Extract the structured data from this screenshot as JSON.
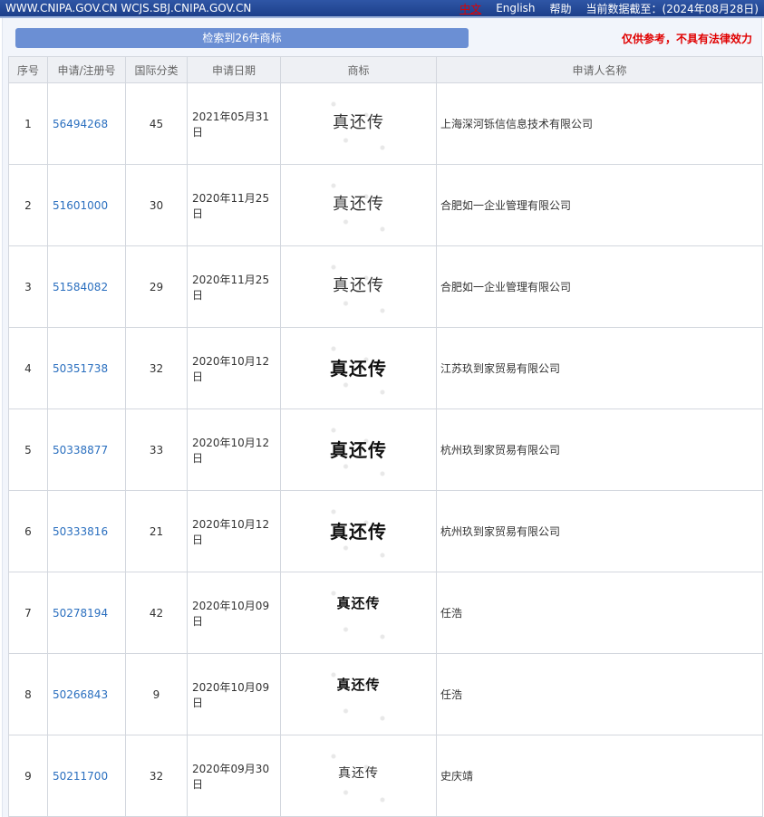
{
  "topbar": {
    "site": "WWW.CNIPA.GOV.CN WCJS.SBJ.CNIPA.GOV.CN",
    "lang_zh": "中文",
    "lang_en": "English",
    "help": "帮助",
    "data_as_of": "当前数据截至：(2024年08月28日)"
  },
  "summary": {
    "result_label": "检索到26件商标",
    "notice": "仅供参考，不具有法律效力"
  },
  "table": {
    "headers": [
      "序号",
      "申请/注册号",
      "国际分类",
      "申请日期",
      "商标",
      "申请人名称"
    ],
    "rows": [
      {
        "seq": "1",
        "reg": "56494268",
        "cls": "45",
        "date": "2021年05月31日",
        "mark": "真还传",
        "applicant": "上海深河铄信信息技术有限公司"
      },
      {
        "seq": "2",
        "reg": "51601000",
        "cls": "30",
        "date": "2020年11月25日",
        "mark": "真还传",
        "applicant": "合肥如一企业管理有限公司"
      },
      {
        "seq": "3",
        "reg": "51584082",
        "cls": "29",
        "date": "2020年11月25日",
        "mark": "真还传",
        "applicant": "合肥如一企业管理有限公司"
      },
      {
        "seq": "4",
        "reg": "50351738",
        "cls": "32",
        "date": "2020年10月12日",
        "mark": "真还传",
        "applicant": "江苏玖到家贸易有限公司"
      },
      {
        "seq": "5",
        "reg": "50338877",
        "cls": "33",
        "date": "2020年10月12日",
        "mark": "真还传",
        "applicant": "杭州玖到家贸易有限公司"
      },
      {
        "seq": "6",
        "reg": "50333816",
        "cls": "21",
        "date": "2020年10月12日",
        "mark": "真还传",
        "applicant": "杭州玖到家贸易有限公司"
      },
      {
        "seq": "7",
        "reg": "50278194",
        "cls": "42",
        "date": "2020年10月09日",
        "mark": "真还传",
        "applicant": "任浩"
      },
      {
        "seq": "8",
        "reg": "50266843",
        "cls": "9",
        "date": "2020年10月09日",
        "mark": "真还传",
        "applicant": "任浩"
      },
      {
        "seq": "9",
        "reg": "50211700",
        "cls": "32",
        "date": "2020年09月30日",
        "mark": "真还传",
        "applicant": "史庆靖"
      }
    ]
  }
}
